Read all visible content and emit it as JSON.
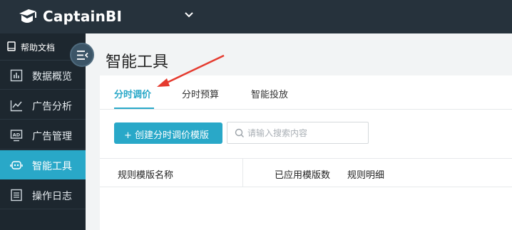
{
  "header": {
    "brand": "CaptainBI"
  },
  "sidebar": {
    "help_label": "帮助文档",
    "items": [
      {
        "label": "数据概览",
        "active": false
      },
      {
        "label": "广告分析",
        "active": false
      },
      {
        "label": "广告管理",
        "active": false
      },
      {
        "label": "智能工具",
        "active": true
      },
      {
        "label": "操作日志",
        "active": false
      }
    ]
  },
  "main": {
    "title": "智能工具",
    "tabs": [
      {
        "label": "分时调价",
        "active": true
      },
      {
        "label": "分时预算",
        "active": false
      },
      {
        "label": "智能投放",
        "active": false
      }
    ],
    "create_button": "+ 创建分时调价模版",
    "search_placeholder": "请输入搜索内容",
    "table": {
      "columns": [
        "规则模版名称",
        "已应用模版数",
        "规则明细"
      ]
    }
  },
  "colors": {
    "accent": "#29a8c8",
    "topbar": "#26323c",
    "sidebar": "#1d272f",
    "annotation": "#e53b2f"
  }
}
